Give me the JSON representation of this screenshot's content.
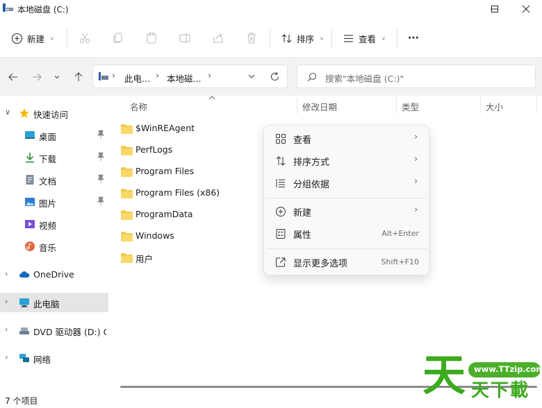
{
  "window": {
    "title": "本地磁盘 (C:)"
  },
  "toolbar": {
    "new_label": "新建",
    "sort_label": "排序",
    "view_label": "查看",
    "more_label": "···"
  },
  "address": {
    "crumbs": [
      "此电...",
      "本地磁..."
    ]
  },
  "search": {
    "placeholder": "搜索\"本地磁盘 (C:)\""
  },
  "sidebar": {
    "items": [
      {
        "label": "快速访问",
        "icon": "star-icon"
      },
      {
        "label": "桌面",
        "icon": "desktop-icon"
      },
      {
        "label": "下载",
        "icon": "download-icon"
      },
      {
        "label": "文档",
        "icon": "document-icon"
      },
      {
        "label": "图片",
        "icon": "picture-icon"
      },
      {
        "label": "视频",
        "icon": "video-icon"
      },
      {
        "label": "音乐",
        "icon": "music-icon"
      },
      {
        "label": "OneDrive",
        "icon": "cloud-icon"
      },
      {
        "label": "此电脑",
        "icon": "pc-icon"
      },
      {
        "label": "DVD 驱动器 (D:) CP",
        "icon": "dvd-icon"
      },
      {
        "label": "网络",
        "icon": "network-icon"
      }
    ]
  },
  "columns": {
    "name": "名称",
    "modified": "修改日期",
    "type": "类型",
    "size": "大小"
  },
  "files": [
    {
      "name": "$WinREAgent"
    },
    {
      "name": "PerfLogs"
    },
    {
      "name": "Program Files"
    },
    {
      "name": "Program Files (x86)"
    },
    {
      "name": "ProgramData"
    },
    {
      "name": "Windows"
    },
    {
      "name": "用户"
    }
  ],
  "context_menu": {
    "items": [
      {
        "label": "查看",
        "icon": "grid-icon",
        "submenu": true
      },
      {
        "label": "排序方式",
        "icon": "sort-icon",
        "submenu": true
      },
      {
        "label": "分组依据",
        "icon": "group-icon",
        "submenu": true
      },
      {
        "label": "新建",
        "icon": "plus-circle-icon",
        "submenu": true
      },
      {
        "label": "属性",
        "icon": "properties-icon",
        "shortcut": "Alt+Enter"
      },
      {
        "label": "显示更多选项",
        "icon": "more-options-icon",
        "shortcut": "Shift+F10"
      }
    ]
  },
  "status": {
    "item_count": "7 个项目"
  },
  "watermark": {
    "big_char": "天",
    "url": "www.TTzip.com",
    "text": "天下載"
  },
  "colors": {
    "accent": "#0067c0",
    "folder": "#f4c84c",
    "watermark": "#3cab1f"
  }
}
